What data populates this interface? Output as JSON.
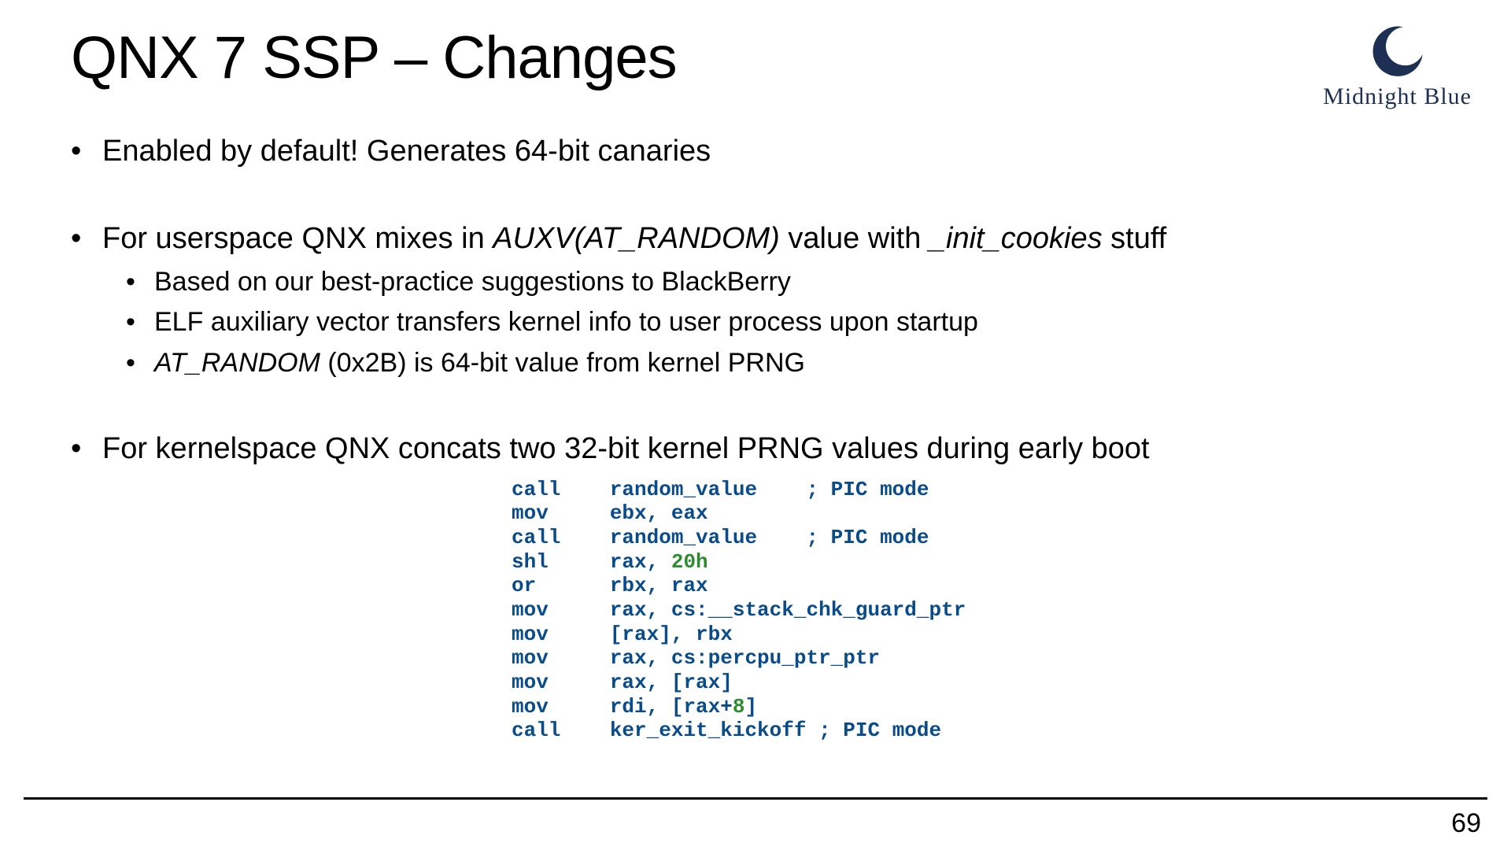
{
  "title": "QNX 7 SSP – Changes",
  "logo": {
    "name": "moon-icon",
    "text": "Midnight Blue",
    "color": "#1d2f53"
  },
  "bullets": {
    "b1": "Enabled by default! Generates 64-bit canaries",
    "b2_pre": "For userspace QNX mixes in ",
    "b2_em1": "AUXV(AT_RANDOM)",
    "b2_mid": " value with ",
    "b2_em2": "_init_cookies",
    "b2_post": " stuff",
    "b2_sub1": "Based on our best-practice suggestions to BlackBerry",
    "b2_sub2": "ELF auxiliary vector transfers kernel info to user process upon startup",
    "b2_sub3_em": "AT_RANDOM",
    "b2_sub3_rest": " (0x2B) is 64-bit value from kernel PRNG",
    "b3": "For kernelspace QNX concats two 32-bit kernel PRNG values during early boot"
  },
  "code": {
    "l1_a": "call    ",
    "l1_b": "random_value    ",
    "l1_c": "; PIC mode",
    "l2_a": "mov     ",
    "l2_b": "ebx, eax",
    "l3_a": "call    ",
    "l3_b": "random_value    ",
    "l3_c": "; PIC mode",
    "l4_a": "shl     ",
    "l4_b": "rax, ",
    "l4_num": "20h",
    "l5_a": "or      ",
    "l5_b": "rbx, rax",
    "l6_a": "mov     ",
    "l6_b": "rax, cs:__stack_chk_guard_ptr",
    "l7_a": "mov     ",
    "l7_b": "[rax], rbx",
    "l8_a": "mov     ",
    "l8_b": "rax, cs:percpu_ptr_ptr",
    "l9_a": "mov     ",
    "l9_b": "rax, [rax]",
    "l10_a": "mov     ",
    "l10_b": "rdi, [rax+",
    "l10_num": "8",
    "l10_c": "]",
    "l11_a": "call    ",
    "l11_b": "ker_exit_kickoff ",
    "l11_c": "; PIC mode"
  },
  "page_number": "69"
}
